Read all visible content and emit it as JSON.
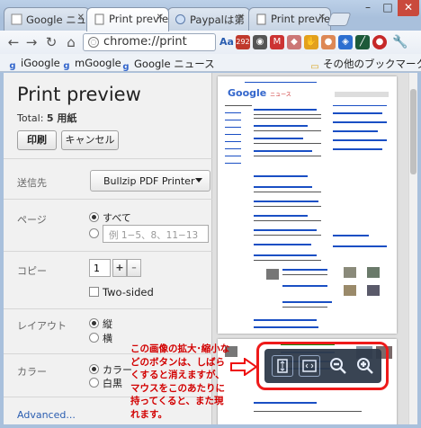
{
  "tabs": [
    {
      "label": "Google ニュー",
      "icon": "google-icon"
    },
    {
      "label": "Print preview",
      "icon": "page-icon",
      "active": true
    },
    {
      "label": "Paypalは第",
      "icon": "paypal-icon"
    },
    {
      "label": "Print preview",
      "icon": "page-icon"
    }
  ],
  "address_bar": {
    "url": "chrome://print"
  },
  "bookmarks": [
    {
      "label": "iGoogle"
    },
    {
      "label": "mGoogle"
    },
    {
      "label": "Google ニュース"
    }
  ],
  "other_bookmarks": "その他のブックマーク",
  "extension_badge": "292",
  "sidebar": {
    "title": "Print preview",
    "total_label": "Total:",
    "total_value": "5 用紙",
    "print_button": "印刷",
    "cancel_button": "キャンセル",
    "destination_label": "送信先",
    "destination_value": "Bullzip PDF Printer",
    "pages_label": "ページ",
    "pages_all": "すべて",
    "pages_placeholder": "例 1−5、8、11−13",
    "copies_label": "コピー",
    "copies_value": "1",
    "copies_plus": "+",
    "copies_minus": "–",
    "two_sided": "Two-sided",
    "layout_label": "レイアウト",
    "layout_portrait": "縦",
    "layout_landscape": "横",
    "color_label": "カラー",
    "color_color": "カラー",
    "color_bw": "白黒",
    "advanced": "Advanced..."
  },
  "preview": {
    "logo": "Google",
    "logo_sub": "ニュース"
  },
  "annotation": {
    "text": "この画像の拡大･縮小などのボタンは、しばらくすると消えますが、マウスをこのあたりに持ってくると、また現れます。"
  },
  "zoom_toolbar": {
    "buttons": [
      "fit-page",
      "fit-width",
      "zoom-out",
      "zoom-in"
    ]
  },
  "colors": {
    "accent_red": "#ee1a1a",
    "link_blue": "#2a5db0"
  }
}
